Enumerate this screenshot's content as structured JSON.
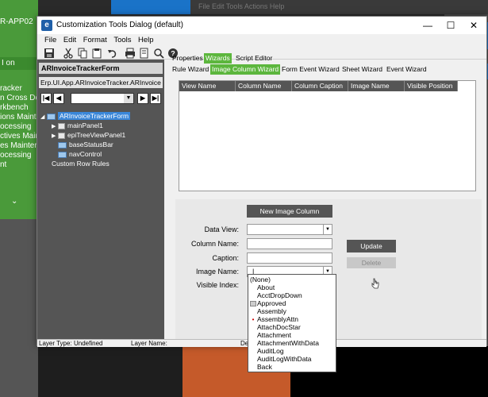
{
  "background": {
    "app_label": "R-APP02",
    "user_text": "I on",
    "menu_items": [
      "racker",
      "n Cross De",
      "rkbench",
      "ions Mainte",
      "ocessing",
      "ctives Main",
      "es Mainter",
      "ocessing",
      "",
      "nt"
    ],
    "top_menu": "File  Edit  Tools  Actions  Help"
  },
  "window": {
    "title": "Customization Tools Dialog (default)",
    "minimize": "—",
    "maximize": "☐",
    "close": "✕"
  },
  "menubar": [
    "File",
    "Edit",
    "Format",
    "Tools",
    "Help"
  ],
  "toolbar_icons": [
    "save-icon",
    "cut-icon",
    "copy-icon",
    "paste-icon",
    "undo-icon",
    "print-icon",
    "print-preview-icon",
    "search-icon",
    "help-icon"
  ],
  "left_panel": {
    "title": "ARInvoiceTrackerForm",
    "path": "Erp.UI.App.ARInvoiceTracker.ARInvoice",
    "nav": {
      "first": "|◀",
      "prev": "◀",
      "next": "▶",
      "last": "▶|",
      "combo_arrow": "▼"
    },
    "tree": [
      {
        "label": "ARInvoiceTrackerForm",
        "selected": true,
        "exp": "◢"
      },
      {
        "label": "mainPanel1",
        "exp": "▶"
      },
      {
        "label": "epiTreeViewPanel1",
        "exp": "▶"
      },
      {
        "label": "baseStatusBar"
      },
      {
        "label": "navControl"
      },
      {
        "label": "Custom Row Rules"
      }
    ]
  },
  "tabs": {
    "top": [
      "Properties",
      "Wizards",
      "Script Editor"
    ],
    "second": [
      "Rule Wizard",
      "Image Column Wizard",
      "Form Event Wizard",
      "Sheet Wizard",
      "Event Wizard"
    ]
  },
  "grid": {
    "columns": [
      "View Name",
      "Column Name",
      "Column Caption",
      "Image Name",
      "Visible Position"
    ]
  },
  "form": {
    "new_image_column": "New Image Column",
    "labels": {
      "data_view": "Data View:",
      "column_name": "Column Name:",
      "caption": "Caption:",
      "image_name": "Image Name:",
      "visible_index": "Visible Index:"
    },
    "image_name_value": "|",
    "update": "Update",
    "delete": "Delete",
    "combo_arrow": "▼"
  },
  "dropdown": {
    "items": [
      "(None)",
      "About",
      "AcctDropDown",
      "Approved",
      "Assembly",
      "AssemblyAttn",
      "AttachDocStar",
      "Attachment",
      "AttachmentWithData",
      "AuditLog",
      "AuditLogWithData",
      "Back"
    ]
  },
  "statusbar": {
    "layer_type_label": "Layer Type:",
    "layer_type_value": "Undefined",
    "layer_name_label": "Layer Name:",
    "trailing": "De"
  },
  "colors": {
    "accent_green": "#5cb63d",
    "selected_blue": "#3a86d8",
    "dark_button": "#555555"
  }
}
